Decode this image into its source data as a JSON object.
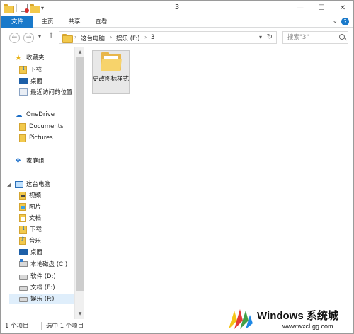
{
  "window": {
    "title": "3",
    "controls": {
      "minimize": "—",
      "maximize": "☐",
      "close": "✕"
    }
  },
  "ribbon": {
    "tabs": [
      "文件",
      "主页",
      "共享",
      "查看"
    ],
    "help": "?"
  },
  "address_bar": {
    "back": "←",
    "forward": "→",
    "up": "↑",
    "crumbs": [
      "这台电脑",
      "娱乐 (F:)",
      "3"
    ],
    "search_placeholder": "搜索\"3\""
  },
  "nav_pane": {
    "favorites": {
      "label": "收藏夹",
      "items": [
        "下载",
        "桌面",
        "最近访问的位置"
      ]
    },
    "onedrive": {
      "label": "OneDrive",
      "items": [
        "Documents",
        "Pictures"
      ]
    },
    "homegroup": {
      "label": "家庭组"
    },
    "this_pc": {
      "label": "这台电脑",
      "items": [
        "视频",
        "图片",
        "文档",
        "下载",
        "音乐",
        "桌面",
        "本地磁盘 (C:)",
        "软件 (D:)",
        "文档 (E:)",
        "娱乐 (F:)"
      ]
    }
  },
  "content": {
    "items": [
      {
        "name": "更改图标样式",
        "type": "folder"
      }
    ]
  },
  "status": {
    "item_count": "1 个项目",
    "selected": "选中 1 个项目"
  },
  "watermark": {
    "main": "Windows 系统城",
    "url": "www.wxcLgg.com"
  },
  "colors": {
    "accent": "#1979ca",
    "selected_bg": "#dfeefb",
    "folder": "#f2c94c"
  }
}
